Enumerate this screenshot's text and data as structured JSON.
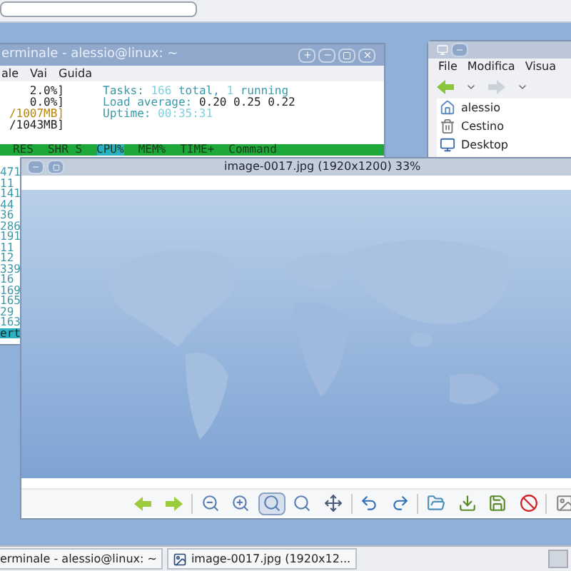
{
  "terminal": {
    "title": "erminale - alessio@linux: ~",
    "menu": [
      {
        "label": "ale"
      },
      {
        "label": "Vai"
      },
      {
        "label": "Guida"
      }
    ],
    "meters": [
      "2.0%]",
      "0.0%]",
      "/1007MB]",
      "/1043MB]"
    ],
    "stats": [
      [
        {
          "text": "Tasks: ",
          "kind": "label"
        },
        {
          "text": "166",
          "kind": "value"
        },
        {
          "text": " total, ",
          "kind": "label"
        },
        {
          "text": "1",
          "kind": "value"
        },
        {
          "text": " running",
          "kind": "label"
        }
      ],
      [
        {
          "text": "Load average: ",
          "kind": "label"
        },
        {
          "text": "0.20 0.25 0.22",
          "kind": "plain"
        }
      ],
      [
        {
          "text": "Uptime: ",
          "kind": "label"
        },
        {
          "text": "00:35:31",
          "kind": "value"
        }
      ]
    ],
    "columns": [
      "RES",
      "SHR S",
      "CPU%",
      "MEM%",
      "TIME+",
      "Command"
    ],
    "rows": [
      {
        "text": "471",
        "selected": false
      },
      {
        "text": "11",
        "selected": false
      },
      {
        "text": "141",
        "selected": false
      },
      {
        "text": "44",
        "selected": false
      },
      {
        "text": "36",
        "selected": false
      },
      {
        "text": "286",
        "selected": false
      },
      {
        "text": "191",
        "selected": false
      },
      {
        "text": "11",
        "selected": false
      },
      {
        "text": "12",
        "selected": false
      },
      {
        "text": "339",
        "selected": false
      },
      {
        "text": "16",
        "selected": false
      },
      {
        "text": "169",
        "selected": false
      },
      {
        "text": "165",
        "selected": false
      },
      {
        "text": "29",
        "selected": false
      },
      {
        "text": "163",
        "selected": false
      },
      {
        "text": "ert",
        "selected": true
      }
    ]
  },
  "file_manager": {
    "menu": [
      {
        "label": "File"
      },
      {
        "label": "Modifica"
      },
      {
        "label": "Visua"
      }
    ],
    "places": [
      {
        "label": "alessio",
        "kind": "home"
      },
      {
        "label": "Cestino",
        "kind": "trash"
      },
      {
        "label": "Desktop",
        "kind": "desktop"
      }
    ]
  },
  "image_viewer": {
    "title": "image-0017.jpg (1920x1200) 33%",
    "toolbar": [
      {
        "kind": "back",
        "selected": false
      },
      {
        "kind": "forward",
        "selected": false
      },
      {
        "kind": "zoom-out",
        "selected": false
      },
      {
        "kind": "zoom-in",
        "selected": false
      },
      {
        "kind": "zoom-fit",
        "selected": true
      },
      {
        "kind": "zoom-normal",
        "selected": false
      },
      {
        "kind": "fullscreen",
        "selected": false
      },
      {
        "kind": "rotate-left",
        "selected": false
      },
      {
        "kind": "rotate-right",
        "selected": false
      },
      {
        "kind": "open",
        "selected": false
      },
      {
        "kind": "save",
        "selected": false
      },
      {
        "kind": "save-as",
        "selected": false
      },
      {
        "kind": "delete",
        "selected": false
      },
      {
        "kind": "more",
        "selected": false
      }
    ]
  },
  "taskbar": [
    {
      "label": "erminale - alessio@linux: ~",
      "selected": false
    },
    {
      "label": "image-0017.jpg (1920x12...",
      "selected": false
    }
  ]
}
